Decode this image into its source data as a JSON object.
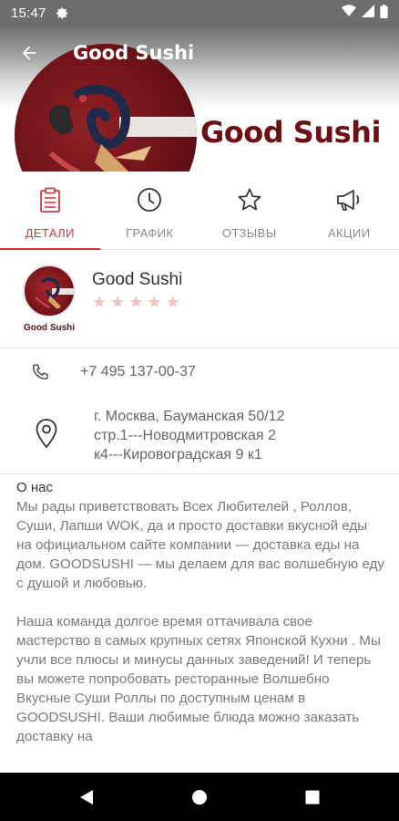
{
  "status_bar": {
    "time": "15:47",
    "icons": [
      "gear-icon",
      "wifi-icon",
      "signal-icon",
      "battery-icon"
    ]
  },
  "header": {
    "title": "Good Sushi",
    "banner_text": "Good Sushi"
  },
  "tabs": [
    {
      "label": "ДЕТАЛИ",
      "icon": "clipboard-icon",
      "active": true
    },
    {
      "label": "ГРАФИК",
      "icon": "clock-icon",
      "active": false
    },
    {
      "label": "ОТЗЫВЫ",
      "icon": "star-icon",
      "active": false
    },
    {
      "label": "АКЦИИ",
      "icon": "megaphone-icon",
      "active": false
    }
  ],
  "business": {
    "name": "Good Sushi",
    "logo_text": "Good Sushi",
    "rating": 0,
    "rating_max": 5
  },
  "contact": {
    "phone": "+7 495 137-00-37",
    "address": [
      "г. Москва, Бауманская 50/12",
      "стр.1---Новодмитровская 2",
      "к4---Кировоградская 9 к1"
    ]
  },
  "about": {
    "heading": "О нас",
    "paragraphs": [
      "Мы рады приветствовать Всех Любителей , Роллов, Суши, Лапши WOK, да и просто доставки вкусной еды на официальном сайте компании  —  доставка еды на дом. GOODSUSHI — мы делаем для вас волшебную еду с душой и любовью.",
      "Наша команда долгое время оттачивала свое мастерство в самых крупных сетях Японской Кухни . Мы учли все плюсы и минусы данных заведений! И теперь вы можете попробовать ресторанные Волшебно Вкусные Суши Роллы по доступным ценам в GOODSUSHI. Ваши любимые блюда можно заказать доставку на"
    ]
  },
  "colors": {
    "accent": "#d23a3f",
    "brand_dark": "#6d0f16",
    "star_empty": "#f0c2c4"
  }
}
